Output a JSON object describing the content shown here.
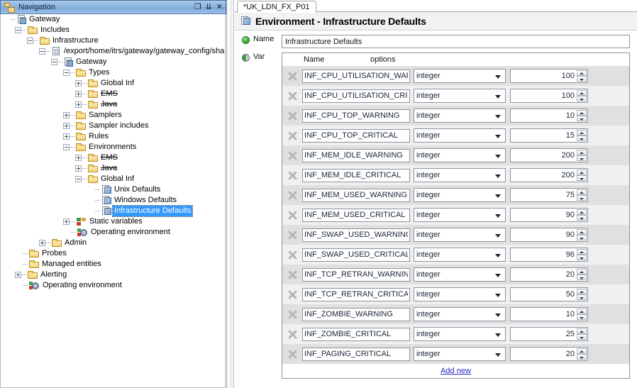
{
  "nav": {
    "title": "Navigation",
    "window_icon": "navigation-icon",
    "controls": [
      {
        "name": "restore-button",
        "glyph": "❐"
      },
      {
        "name": "pin-button",
        "glyph": "⇊"
      },
      {
        "name": "close-button",
        "glyph": "✕"
      }
    ],
    "tree": [
      {
        "label": "Gateway",
        "depth": 0,
        "icon": "gateway-doc-icon",
        "toggle": "none",
        "strike": false,
        "selected": false
      },
      {
        "label": "Includes",
        "depth": 1,
        "icon": "folder-icon",
        "toggle": "minus",
        "strike": false,
        "selected": false
      },
      {
        "label": "Infrastructure",
        "depth": 2,
        "icon": "folder-icon",
        "toggle": "minus",
        "strike": false,
        "selected": false
      },
      {
        "label": "/export/home/itrs/gateway/gateway_config/share",
        "depth": 3,
        "icon": "file-icon",
        "toggle": "minus",
        "strike": false,
        "selected": false
      },
      {
        "label": "Gateway",
        "depth": 4,
        "icon": "gateway-doc-icon",
        "toggle": "minus",
        "strike": false,
        "selected": false
      },
      {
        "label": "Types",
        "depth": 5,
        "icon": "folder-icon",
        "toggle": "minus",
        "strike": false,
        "selected": false
      },
      {
        "label": "Global Inf",
        "depth": 6,
        "icon": "folder-icon",
        "toggle": "plus",
        "strike": false,
        "selected": false
      },
      {
        "label": "EMS",
        "depth": 6,
        "icon": "folder-icon",
        "toggle": "plus",
        "strike": true,
        "selected": false
      },
      {
        "label": "Java",
        "depth": 6,
        "icon": "folder-icon",
        "toggle": "plus",
        "strike": true,
        "selected": false
      },
      {
        "label": "Samplers",
        "depth": 5,
        "icon": "folder-icon",
        "toggle": "plus",
        "strike": false,
        "selected": false
      },
      {
        "label": "Sampler includes",
        "depth": 5,
        "icon": "folder-icon",
        "toggle": "plus",
        "strike": false,
        "selected": false
      },
      {
        "label": "Rules",
        "depth": 5,
        "icon": "folder-icon",
        "toggle": "plus",
        "strike": false,
        "selected": false
      },
      {
        "label": "Environments",
        "depth": 5,
        "icon": "folder-icon",
        "toggle": "minus",
        "strike": false,
        "selected": false
      },
      {
        "label": "EMS",
        "depth": 6,
        "icon": "folder-icon",
        "toggle": "plus",
        "strike": true,
        "selected": false
      },
      {
        "label": "Java",
        "depth": 6,
        "icon": "folder-icon",
        "toggle": "plus",
        "strike": true,
        "selected": false
      },
      {
        "label": "Global Inf",
        "depth": 6,
        "icon": "folder-icon",
        "toggle": "minus",
        "strike": false,
        "selected": false
      },
      {
        "label": "Unix Defaults",
        "depth": 7,
        "icon": "environment-icon",
        "toggle": "leaf",
        "strike": false,
        "selected": false
      },
      {
        "label": "Windows Defaults",
        "depth": 7,
        "icon": "environment-icon",
        "toggle": "leaf",
        "strike": false,
        "selected": false
      },
      {
        "label": "Infrastructure Defaults",
        "depth": 7,
        "icon": "environment-icon",
        "toggle": "leaf",
        "strike": false,
        "selected": true
      },
      {
        "label": "Static variables",
        "depth": 5,
        "icon": "static-vars-icon",
        "toggle": "plus",
        "strike": false,
        "selected": false
      },
      {
        "label": "Operating environment",
        "depth": 5,
        "icon": "operating-env-icon",
        "toggle": "leaf",
        "strike": false,
        "selected": false
      },
      {
        "label": "Admin",
        "depth": 3,
        "icon": "folder-icon",
        "toggle": "plus",
        "strike": false,
        "selected": false
      },
      {
        "label": "Probes",
        "depth": 1,
        "icon": "folder-icon",
        "toggle": "leaf",
        "strike": false,
        "selected": false
      },
      {
        "label": "Managed entities",
        "depth": 1,
        "icon": "folder-icon",
        "toggle": "leaf",
        "strike": false,
        "selected": false
      },
      {
        "label": "Alerting",
        "depth": 1,
        "icon": "folder-icon",
        "toggle": "plus",
        "strike": false,
        "selected": false
      },
      {
        "label": "Operating environment",
        "depth": 1,
        "icon": "operating-env-icon",
        "toggle": "leaf",
        "strike": false,
        "selected": false
      }
    ]
  },
  "editor": {
    "tab_label": "*UK_LDN_FX_P01",
    "title": "Environment - Infrastructure Defaults",
    "title_icon": "environment-icon",
    "name_label": "Name",
    "name_value": "Infrastructure Defaults",
    "var_label": "Var",
    "columns": {
      "name": "Name",
      "options": "options"
    },
    "add_new_label": "Add new",
    "variables": [
      {
        "name": "INF_CPU_UTILISATION_WARNING",
        "type": "integer",
        "value": "100"
      },
      {
        "name": "INF_CPU_UTILISATION_CRITICAL",
        "type": "integer",
        "value": "100"
      },
      {
        "name": "INF_CPU_TOP_WARNING",
        "type": "integer",
        "value": "10"
      },
      {
        "name": "INF_CPU_TOP_CRITICAL",
        "type": "integer",
        "value": "15"
      },
      {
        "name": "INF_MEM_IDLE_WARNING",
        "type": "integer",
        "value": "200"
      },
      {
        "name": "INF_MEM_IDLE_CRITICAL",
        "type": "integer",
        "value": "200"
      },
      {
        "name": "INF_MEM_USED_WARNING",
        "type": "integer",
        "value": "75"
      },
      {
        "name": "INF_MEM_USED_CRITICAL",
        "type": "integer",
        "value": "90"
      },
      {
        "name": "INF_SWAP_USED_WARNING",
        "type": "integer",
        "value": "90"
      },
      {
        "name": "INF_SWAP_USED_CRITICAL",
        "type": "integer",
        "value": "96"
      },
      {
        "name": "INF_TCP_RETRAN_WARNING",
        "type": "integer",
        "value": "20"
      },
      {
        "name": "INF_TCP_RETRAN_CRITICAL",
        "type": "integer",
        "value": "50"
      },
      {
        "name": "INF_ZOMBIE_WARNING",
        "type": "integer",
        "value": "10"
      },
      {
        "name": "INF_ZOMBIE_CRITICAL",
        "type": "integer",
        "value": "25"
      },
      {
        "name": "INF_PAGING_CRITICAL",
        "type": "integer",
        "value": "20"
      }
    ]
  },
  "colors": {
    "titlebar": "#8fb6e0",
    "selection": "#3399ff",
    "link": "#2a28c8",
    "row_odd": "#e0e0e0",
    "row_even": "#f0f0f0"
  }
}
